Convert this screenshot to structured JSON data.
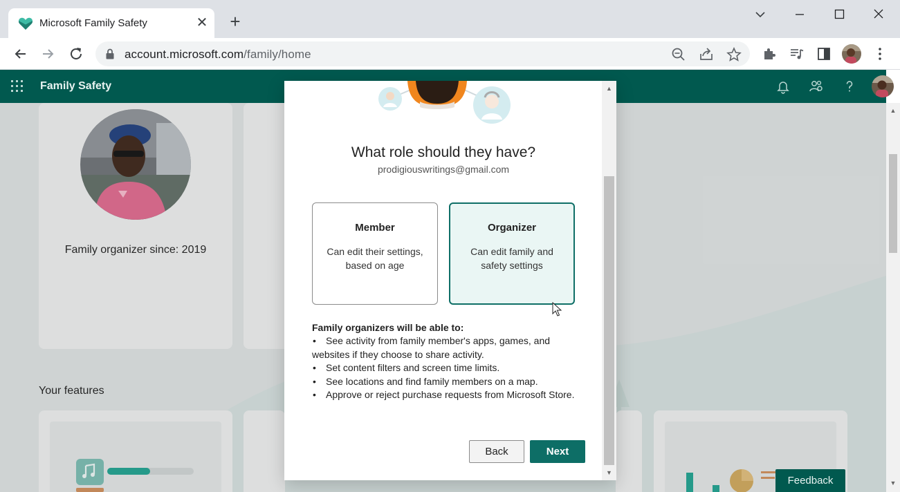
{
  "browser": {
    "tab_title": "Microsoft Family Safety",
    "tab_close": "✕",
    "new_tab": "+",
    "url_host": "account.microsoft.com",
    "url_path": "/family/home"
  },
  "app": {
    "name": "Family Safety"
  },
  "profile": {
    "organizer_since": "Family organizer since: 2019"
  },
  "features": {
    "title": "Your features"
  },
  "feedback": {
    "label": "Feedback"
  },
  "modal": {
    "title": "What role should they have?",
    "email": "prodigiouswritings@gmail.com",
    "roles": [
      {
        "name": "Member",
        "description": "Can edit their settings, based on age",
        "selected": false
      },
      {
        "name": "Organizer",
        "description": "Can edit family and safety settings",
        "selected": true
      }
    ],
    "benefits_title": "Family organizers will be able to:",
    "benefits": [
      "See activity from family member's apps, games, and websites if they choose to share activity.",
      "Set content filters and screen time limits.",
      "See locations and find family members on a map.",
      "Approve or reject purchase requests from Microsoft Store."
    ],
    "back_label": "Back",
    "next_label": "Next"
  },
  "colors": {
    "brand": "#01594f",
    "accent": "#0d6e66",
    "selected_bg": "#eaf6f4"
  }
}
